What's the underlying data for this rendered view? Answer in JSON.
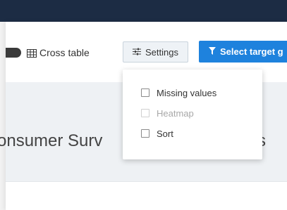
{
  "toolbar": {
    "cross_table_label": "Cross table",
    "settings_label": "Settings",
    "select_target_label": "Select target g"
  },
  "main": {
    "title_start": "onsumer Surv",
    "title_end": "s"
  },
  "settings_menu": {
    "items": [
      {
        "label": "Missing values",
        "checked": false,
        "disabled": false
      },
      {
        "label": "Heatmap",
        "checked": false,
        "disabled": true
      },
      {
        "label": "Sort",
        "checked": false,
        "disabled": false
      }
    ]
  },
  "colors": {
    "topbar": "#1c2c44",
    "accent": "#1e82dd",
    "band": "#eef1f4"
  },
  "icons": {
    "toggle": "toggle-switch-icon",
    "cross_table": "grid-table-icon",
    "settings": "sliders-icon",
    "select_target": "filter-icon"
  }
}
